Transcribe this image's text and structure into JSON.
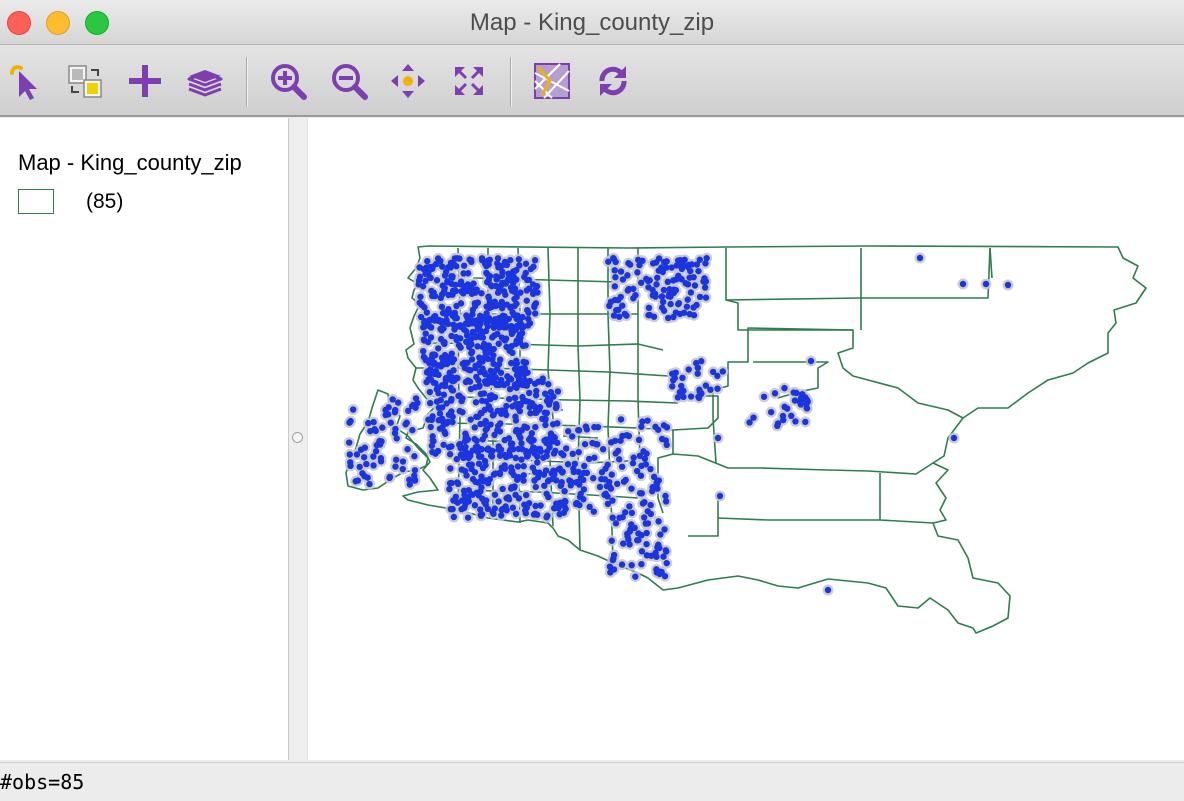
{
  "window": {
    "title": "Map - King_county_zip"
  },
  "toolbar": {
    "buttons": [
      {
        "name": "select-tool",
        "icon": "select-arrow-icon"
      },
      {
        "name": "map-options",
        "icon": "map-copy-icon"
      },
      {
        "name": "add-layer",
        "icon": "plus-icon"
      },
      {
        "name": "layers",
        "icon": "layers-icon"
      },
      {
        "name": "zoom-in",
        "icon": "zoom-in-icon"
      },
      {
        "name": "zoom-out",
        "icon": "zoom-out-icon"
      },
      {
        "name": "pan",
        "icon": "pan-arrows-icon"
      },
      {
        "name": "full-extent",
        "icon": "full-extent-icon"
      },
      {
        "name": "basemap",
        "icon": "basemap-icon"
      },
      {
        "name": "refresh",
        "icon": "refresh-icon"
      }
    ]
  },
  "legend": {
    "title": "Map - King_county_zip",
    "items": [
      {
        "label": "(85)"
      }
    ]
  },
  "colors": {
    "boundary": "#2e7d4f",
    "point_fill": "#1a35e0",
    "point_halo": "#c8c8c8",
    "icon_purple": "#7d3fb0",
    "icon_yellow": "#f0b400"
  },
  "status": {
    "text": "#obs=85"
  }
}
